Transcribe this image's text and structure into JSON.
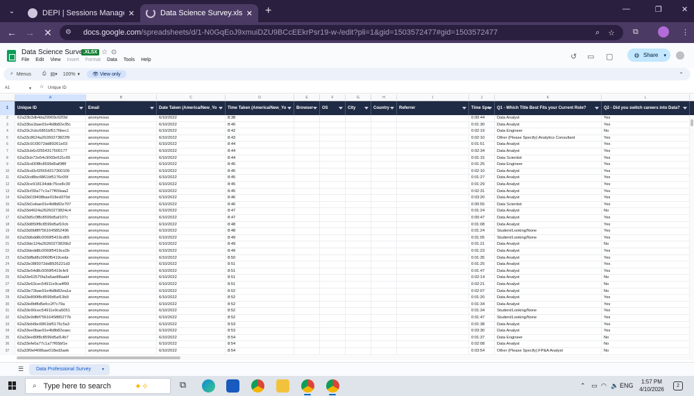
{
  "browser": {
    "tabs": [
      {
        "title": "DEPI | Sessions Management",
        "active": false
      },
      {
        "title": "Data Science Survey.xlsx - Goo",
        "active": true
      }
    ],
    "url_domain": "docs.google.com",
    "url_path": "/spreadsheets/d/1-N0GqEoJ9xmuiDZU9BCcEEkrPsr19-w-/edit?pli=1&gid=1503572477#gid=1503572477"
  },
  "doc": {
    "title": "Data Science Survey",
    "badge": ".XLSX",
    "menus": [
      "File",
      "Edit",
      "View",
      "Insert",
      "Format",
      "Data",
      "Tools",
      "Help"
    ],
    "disabled_menus": [
      "Insert",
      "Format"
    ],
    "share_label": "Share"
  },
  "toolbar": {
    "menus_label": "Menus",
    "zoom": "100%",
    "view_only": "View only"
  },
  "formula_bar": {
    "cell_ref": "A1",
    "value": "Unique ID"
  },
  "sheet": {
    "column_letters": [
      "A",
      "B",
      "C",
      "D",
      "E",
      "F",
      "G",
      "H",
      "I",
      "J",
      "K",
      "L"
    ],
    "headers": [
      "Unique ID",
      "Email",
      "Date Taken (America/New_Yo",
      "Time Taken (America/New_Yo",
      "Browser",
      "OS",
      "City",
      "Country",
      "Referrer",
      "Time Spe",
      "Q1 - Which Title Best Fits your Current Role?",
      "Q2 - Did you switch careers into Data?"
    ],
    "rows": [
      {
        "n": "2",
        "id": "62a33b3db4da29969c62f3d",
        "date": "6/10/2022",
        "time": "8:38",
        "spent": "0:00:44",
        "role": "Data Analyst",
        "switch": "Yes"
      },
      {
        "n": "3",
        "id": "62a33ba1bae91e4b8b82e35c",
        "date": "6/10/2022",
        "time": "8:40",
        "spent": "0:01:30",
        "role": "Data Analyst",
        "switch": "Yes"
      },
      {
        "n": "4",
        "id": "62a33c2cbc6861bf5176bec1",
        "date": "6/10/2022",
        "time": "8:42",
        "spent": "0:02:19",
        "role": "Data Engineer",
        "switch": "No"
      },
      {
        "n": "5",
        "id": "62a33c8624a26260273822f9",
        "date": "6/10/2022",
        "time": "8:43",
        "spent": "0:02:10",
        "role": "Other (Please Specify):Analytics Consultant",
        "switch": "Yes"
      },
      {
        "n": "6",
        "id": "62a33c91f3072dd89261e03",
        "date": "6/10/2022",
        "time": "8:44",
        "spent": "0:01:51",
        "role": "Data Analyst",
        "switch": "Yes"
      },
      {
        "n": "7",
        "id": "62a33cb6cf2554317500177",
        "date": "6/10/2022",
        "time": "8:44",
        "spent": "0:02:34",
        "role": "Data Analyst",
        "switch": "Yes"
      },
      {
        "n": "8",
        "id": "62a33cb72e54c9003e531c65",
        "date": "6/10/2022",
        "time": "8:44",
        "spent": "0:01:15",
        "role": "Data Scientist",
        "switch": "Yes"
      },
      {
        "n": "9",
        "id": "62a33cd30f8c8599d5af0f8f",
        "date": "6/10/2022",
        "time": "8:45",
        "spent": "0:01:25",
        "role": "Data Engineer",
        "switch": "Yes"
      },
      {
        "n": "10",
        "id": "62a33cd3cf25554317300109",
        "date": "6/10/2022",
        "time": "8:45",
        "spent": "0:02:10",
        "role": "Data Analyst",
        "switch": "Yes"
      },
      {
        "n": "11",
        "id": "62a33cd8bc6861bf5176c05f",
        "date": "6/10/2022",
        "time": "8:45",
        "spent": "0:01:27",
        "role": "Data Analyst",
        "switch": "Yes"
      },
      {
        "n": "12",
        "id": "62a33ce918134ddc75ce8c30",
        "date": "6/10/2022",
        "time": "8:45",
        "spent": "0:01:29",
        "role": "Data Analyst",
        "switch": "Yes"
      },
      {
        "n": "13",
        "id": "62a33cf30a77c1a77f65baa2",
        "date": "6/10/2022",
        "time": "8:45",
        "spent": "0:02:31",
        "role": "Data Analyst",
        "switch": "Yes"
      },
      {
        "n": "14",
        "id": "62a33d15f408bae018ed370d",
        "date": "6/10/2022",
        "time": "8:46",
        "spent": "0:03:20",
        "role": "Data Analyst",
        "switch": "Yes"
      },
      {
        "n": "15",
        "id": "62a33d1ebae91e4b8b82e707",
        "date": "6/10/2022",
        "time": "8:46",
        "spent": "0:00:55",
        "role": "Data Scientist",
        "switch": "Yes"
      },
      {
        "n": "16",
        "id": "62a33d4624a26260273824c4",
        "date": "6/10/2022",
        "time": "8:47",
        "spent": "0:01:24",
        "role": "Data Analyst",
        "switch": "No"
      },
      {
        "n": "17",
        "id": "62a33d5c0f8c8599d5af107c",
        "date": "6/10/2022",
        "time": "8:47",
        "spent": "0:00:47",
        "role": "Data Analyst",
        "switch": "Yes"
      },
      {
        "n": "18",
        "id": "62a33d850f8c8599d5af10cb",
        "date": "6/10/2022",
        "time": "8:48",
        "spent": "0:01:08",
        "role": "Data Analyst",
        "switch": "Yes"
      },
      {
        "n": "19",
        "id": "62a33d9bf8f7561645852496",
        "date": "6/10/2022",
        "time": "8:48",
        "spent": "0:01:24",
        "role": "Student/Looking/None",
        "switch": "Yes"
      },
      {
        "n": "20",
        "id": "62a33dbdd8c0069f5419cd65",
        "date": "6/10/2022",
        "time": "8:49",
        "spent": "0:01:05",
        "role": "Student/Looking/None",
        "switch": "Yes"
      },
      {
        "n": "21",
        "id": "62a33de124a26260273826b2",
        "date": "6/10/2022",
        "time": "8:49",
        "spent": "0:01:21",
        "role": "Data Analyst",
        "switch": "No"
      },
      {
        "n": "22",
        "id": "62a33dedd8c0069f5419ce2b",
        "date": "6/10/2022",
        "time": "8:49",
        "spent": "0:01:23",
        "role": "Data Analyst",
        "switch": "Yes"
      },
      {
        "n": "23",
        "id": "62a33dfbd8c0060f5419ceda",
        "date": "6/10/2022",
        "time": "8:50",
        "spent": "0:01:35",
        "role": "Data Analyst",
        "switch": "Yes"
      },
      {
        "n": "24",
        "id": "62a33e38f3072dd8926221d3",
        "date": "6/10/2022",
        "time": "8:51",
        "spent": "0:01:25",
        "role": "Data Analyst",
        "switch": "Yes"
      },
      {
        "n": "25",
        "id": "62a33e54d8c0069f5419cfe9",
        "date": "6/10/2022",
        "time": "8:51",
        "spent": "0:01:47",
        "role": "Data Analyst",
        "switch": "Yes"
      },
      {
        "n": "26",
        "id": "62a33e62575fa3a5ae88aabf",
        "date": "6/10/2022",
        "time": "8:51",
        "spent": "0:02:14",
        "role": "Data Analyst",
        "switch": "No"
      },
      {
        "n": "27",
        "id": "62a33e63cec54911e9ca4f99",
        "date": "6/10/2022",
        "time": "8:51",
        "spent": "0:02:21",
        "role": "Data Analyst",
        "switch": "No"
      },
      {
        "n": "28",
        "id": "62a33e72bae91e4b8b82ea1a",
        "date": "6/10/2022",
        "time": "8:52",
        "spent": "0:02:07",
        "role": "Data Analyst",
        "switch": "No"
      },
      {
        "n": "29",
        "id": "62a33e890f8c8599d5af13b9",
        "date": "6/10/2022",
        "time": "8:52",
        "spent": "0:01:20",
        "role": "Data Analyst",
        "switch": "Yes"
      },
      {
        "n": "30",
        "id": "62a33e8bf8d5efcc2f7c79a",
        "date": "6/10/2022",
        "time": "8:52",
        "spent": "0:01:34",
        "role": "Data Analyst",
        "switch": "Yes"
      },
      {
        "n": "31",
        "id": "62a33e90cec54911e9ca5051",
        "date": "6/10/2022",
        "time": "8:52",
        "spent": "0:01:34",
        "role": "Student/Looking/None",
        "switch": "Yes"
      },
      {
        "n": "32",
        "id": "62a33e9dfbf7561645885277b",
        "date": "6/10/2022",
        "time": "8:52",
        "spent": "0:01:47",
        "role": "Student/Looking/None",
        "switch": "Yes"
      },
      {
        "n": "33",
        "id": "62a33eb6bc6861bf5176c5a3",
        "date": "6/10/2022",
        "time": "8:53",
        "spent": "0:01:38",
        "role": "Data Analyst",
        "switch": "Yes"
      },
      {
        "n": "34",
        "id": "62a33ee0bae91e4b8b82eaec",
        "date": "6/10/2022",
        "time": "8:53",
        "spent": "0:03:30",
        "role": "Data Analyst",
        "switch": "Yes"
      },
      {
        "n": "35",
        "id": "62a33ee80f8c8599d5af14b7",
        "date": "6/10/2022",
        "time": "8:54",
        "spent": "0:01:37",
        "role": "Data Engineer",
        "switch": "No"
      },
      {
        "n": "36",
        "id": "62a33efe0a77c1a77f65bf1e",
        "date": "6/10/2022",
        "time": "8:54",
        "spent": "0:02:08",
        "role": "Data Analyst",
        "switch": "No"
      },
      {
        "n": "37",
        "id": "62a33f0ef408bae018ed3aeb",
        "date": "6/10/2022",
        "time": "8:54",
        "spent": "0:03:54",
        "role": "Other (Please Specify):FP&A Analyst",
        "switch": "No"
      }
    ],
    "email_value": "anonymous",
    "tab_name": "Data Professional Survey"
  },
  "taskbar": {
    "search_placeholder": "Type here to search",
    "language": "ENG",
    "time": "1:57 PM",
    "date": "4/10/2026",
    "notifications": "2"
  }
}
